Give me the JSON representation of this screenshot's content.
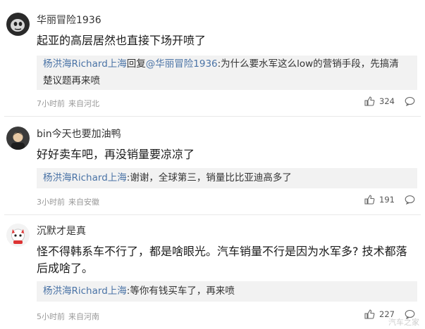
{
  "comments": [
    {
      "username": "华丽冒险1936",
      "text_lines": [
        "起亚的高层居然也直接下场开喷了"
      ],
      "reply": {
        "author": "杨洪海Richard上海",
        "pre": "回复",
        "mention": "@华丽冒险1936",
        "body": ":为什么要水军这么low的营销手段，先搞清",
        "body2": "楚议题再来喷"
      },
      "time": "7小时前",
      "location": "来自河北",
      "likes": "324"
    },
    {
      "username": "bin今天也要加油鸭",
      "text_lines": [
        "好好卖车吧，再没销量要凉凉了"
      ],
      "reply": {
        "author": "杨洪海Richard上海",
        "body": ":谢谢，全球第三，销量比比亚迪高多了"
      },
      "time": "3小时前",
      "location": "来自安徽",
      "likes": "191"
    },
    {
      "username": "沉默才是真",
      "text_lines": [
        "怪不得韩系车不行了，都是啥眼光。汽车销量不行是因为水军多? 技术都落",
        "后成啥了。"
      ],
      "reply": {
        "author": "杨洪海Richard上海",
        "body": ":等你有钱买车了，再来喷"
      },
      "time": "5小时前",
      "location": "来自河南",
      "likes": "227"
    }
  ],
  "icons": {
    "like": "thumbs-up-icon",
    "reply": "comment-bubble-icon"
  },
  "colors": {
    "link": "#4a73a6",
    "reply_bg": "#f2f2f2",
    "meta": "#999999"
  },
  "watermark": "汽车之家"
}
